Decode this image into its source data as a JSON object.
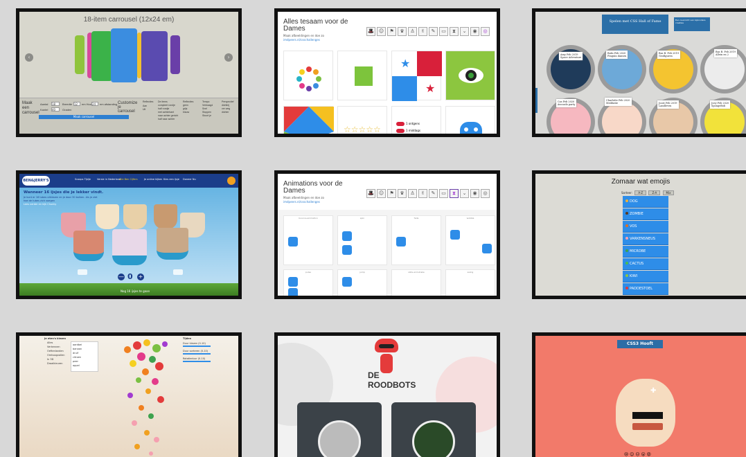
{
  "tiles": [
    {
      "id": "carousel",
      "title": "18-item carrousel (12x24 em)",
      "form": {
        "heading": "Maak een carrousel",
        "field_labels": [
          "Aantal",
          "Breedte",
          "em Hoog",
          "em afstanding",
          "Kantel",
          "Graden"
        ],
        "field_values": [
          "18",
          "12",
          "24",
          "8",
          "40"
        ],
        "button": "Maak carrousel",
        "customize": "Customize je carrousel",
        "reflections_label": "Reflecties",
        "reflections": [
          "Aan",
          "Uit"
        ],
        "items_label": "De items",
        "items": [
          "compleet rondje",
          "half rondje",
          "met achterkant",
          "naar achter gericht",
          "half naar achter"
        ],
        "reflect2_label": "Reflecties",
        "reflect2": [
          "geen",
          "grijs",
          "blauw"
        ],
        "tempo_label": "Tempo",
        "tempo": [
          "Vertraagd",
          "Snel",
          "Stoppen",
          "Stoort je"
        ],
        "perspective_label": "Perspectief",
        "perspective": [
          "dichtbij",
          "ver weg",
          "dichter"
        ]
      }
    },
    {
      "id": "dames",
      "title": "Alles tesaam voor de Dames",
      "sub": "Maak afbeeldingen en doe zo",
      "link": "imdpeers.nl/csschallenges",
      "toolbar_icons": [
        "hat-icon",
        "face-icon",
        "flag-icon",
        "crown-icon",
        "person-icon",
        "emoji-icon",
        "flag-icon",
        "book-icon",
        "hourglass-icon",
        "chevron-icon",
        "eye-icon",
        "spiral-icon"
      ],
      "cards": [
        "dots-circle",
        "green-cube",
        "panama-flag",
        "eye",
        "tangram",
        "stars",
        "toggle-switch",
        "blue-cat"
      ],
      "toggles": [
        "1 ontgens",
        "1 middags"
      ]
    },
    {
      "id": "hall-of-fame",
      "ribbon": "Spelen met CSS Hall of Fame",
      "ribbon_note": "Een overzicht van bijzondere creaties",
      "cards": [
        {
          "name": "Amy",
          "date": "Feb 2019",
          "title": "Space Adventure"
        },
        {
          "name": "Babs",
          "date": "Feb 2020",
          "title": "Pinguin dansen"
        },
        {
          "name": "Bas B.",
          "date": "Feb 2019",
          "title": "Geofiguren"
        },
        {
          "name": "Bas B.",
          "date": "Feb 2019",
          "title": "Allein en 2"
        },
        {
          "name": "Cas",
          "date": "Feb 2020",
          "title": "Avocado party"
        },
        {
          "name": "Charlotte",
          "date": "Feb 2020",
          "title": "Meditatie"
        },
        {
          "name": "Joost",
          "date": "Feb 2019",
          "title": "Landleven"
        },
        {
          "name": "Joey",
          "date": "Feb 2020",
          "title": "SpongeBob"
        }
      ]
    },
    {
      "id": "ben-jerry",
      "logo": "BEN&JERRY'S",
      "nav": [
        "Scoops Tijdje",
        "Versie in Nederland",
        "Alle Ben Cijfers",
        "Je online kijken",
        "Kies een ijsje",
        "Doneer Nu"
      ],
      "heading": "Wanneer 16 ijsjes die je lekker vindt.",
      "text": "Je kunt er 16 tubes uitkiezen en je door 30 bulken. Als je ziet hoe de tubes zich voegen",
      "link_text": "Lees verder en kijk Chunky",
      "counter": "0",
      "minus": "—",
      "plus": "+",
      "footer": "Nog 16 ijsjes te gaan"
    },
    {
      "id": "animations",
      "title": "Animations voor de Dames",
      "sub": "Maak afbeeldingen en doe zo",
      "link": "imdpeers.nl/csschallenges",
      "captions": [
        "bounce-animation",
        "spin",
        "fade",
        "wobble",
        "pulse",
        "jump",
        "slide-and-shake",
        "swing"
      ]
    },
    {
      "id": "emoji",
      "title": "Zomaar wat emojis",
      "sort_label": "Sorteer:",
      "sort_buttons": [
        "A-Z",
        "Z-A",
        "Mix"
      ],
      "items": [
        "DOG",
        "ZOMBIE",
        "VOS",
        "VARKENSNEUS",
        "MICROBE",
        "CACTUS",
        "KIWI",
        "PADDESTOEL"
      ],
      "dots": [
        "#f0b035",
        "#5b3b20",
        "#e07020",
        "#f5a0b0",
        "#3ea24e",
        "#4cbf4c",
        "#8dc63f",
        "#e23b3b"
      ]
    },
    {
      "id": "fruits",
      "panel_title": "Je eten's kiezen",
      "options": [
        "Alles",
        "Verkennen",
        "Oeftenlanden",
        "Omhoogvallen",
        "In 3D",
        "Draaikleuren"
      ],
      "list": [
        "aardbei",
        "banaan",
        "druif",
        "citroen",
        "peer",
        "appel"
      ],
      "right_title": "Tijden",
      "sliders": [
        "Duur kiezen (0-10)",
        "Duur sorteren (0-10)",
        "Rotatieduur (0-10)"
      ]
    },
    {
      "id": "roodbots",
      "title_line1": "DE",
      "title_line2": "ROODBOTS"
    },
    {
      "id": "css3-head",
      "banner": "CSS3 Hooft",
      "emojis": "😢 😊 😐 😮 😡"
    }
  ]
}
